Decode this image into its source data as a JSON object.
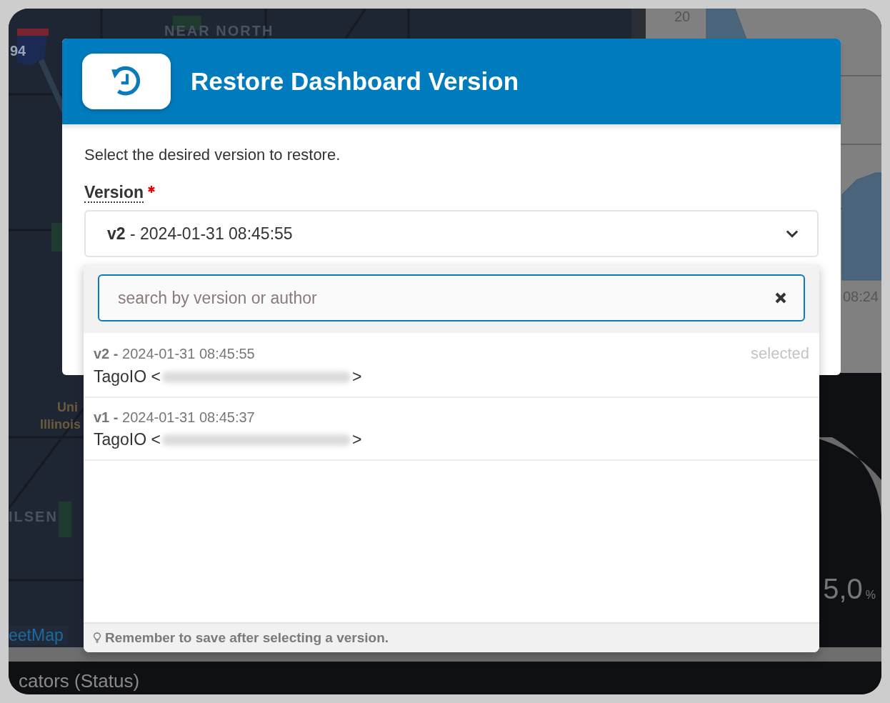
{
  "background": {
    "map_labels": [
      {
        "text": "NEAR NORTH",
        "kind": "district"
      },
      {
        "text": "94",
        "kind": "shield"
      },
      {
        "text": "Uni",
        "kind": "campus"
      },
      {
        "text": "Illinois",
        "kind": "campus"
      },
      {
        "text": "ILSEN",
        "kind": "district"
      },
      {
        "text": "eetMap",
        "kind": "attribution"
      }
    ],
    "chart_labels": [
      "20",
      "08:24"
    ],
    "gauge": {
      "value": "5,0",
      "unit": "%"
    },
    "bottom_title": "cators (Status)"
  },
  "dialog": {
    "title": "Restore Dashboard Version",
    "intro": "Select the desired version to restore.",
    "field": {
      "label": "Version",
      "required": true,
      "value": "**v2** - 2024-01-31 08:45:55",
      "expanded": true
    },
    "dropdown": {
      "search": {
        "placeholder": "search by version or author"
      },
      "versions": [
        {
          "heading": "**v2 -** 2024-01-31 08:45:55",
          "author_prefix": "TagoIO <",
          "author_suffix": ">",
          "selected": true,
          "badge": "selected"
        },
        {
          "heading": "**v1 -** 2024-01-31 08:45:37",
          "author_prefix": "TagoIO <",
          "author_suffix": ">",
          "selected": false
        }
      ],
      "hint": "Remember to save after selecting a version."
    }
  }
}
